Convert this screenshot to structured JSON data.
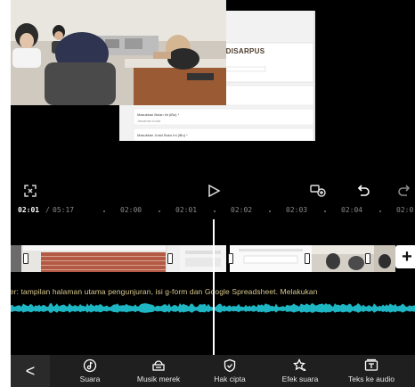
{
  "preview": {
    "form_title": "MAN DISARPUS",
    "question_1": "Masukkan Bulan Ini (iBu) *",
    "question_1_hint": "Jawaban Anda",
    "question_2": "Masukkan Judul Buku Ini (iBu) *"
  },
  "controls": {
    "fullscreen_icon": "fullscreen-icon",
    "play_icon": "play-icon",
    "keyframe_icon": "keyframe-icon",
    "undo_icon": "undo-icon",
    "redo_icon": "redo-icon"
  },
  "ruler": {
    "current_time": "02:01",
    "separator": "/",
    "total_time": "05:17",
    "ticks": [
      "02:00",
      "02:01",
      "02:02",
      "02:03",
      "02:04",
      "02:0"
    ]
  },
  "timeline": {
    "subtitle": "Call to Action Leader: tampilan halaman utama pengunjuran, isi g-form dan Google Spreadsheet. Melakukan",
    "add_icon": "plus-icon",
    "add_label": "+"
  },
  "toolbar": {
    "back_label": "<",
    "items": [
      {
        "icon": "music-note-icon",
        "label": "Suara"
      },
      {
        "icon": "brand-music-icon",
        "label": "Musik merek"
      },
      {
        "icon": "shield-check-icon",
        "label": "Hak cipta"
      },
      {
        "icon": "sound-effect-icon",
        "label": "Efek suara"
      },
      {
        "icon": "text-to-audio-icon",
        "label": "Teks ke audio"
      }
    ]
  },
  "colors": {
    "background": "#000000",
    "waveform": "#1fb6c4",
    "subtitle": "#d9c98e",
    "toolbar": "#1f1f1f"
  }
}
